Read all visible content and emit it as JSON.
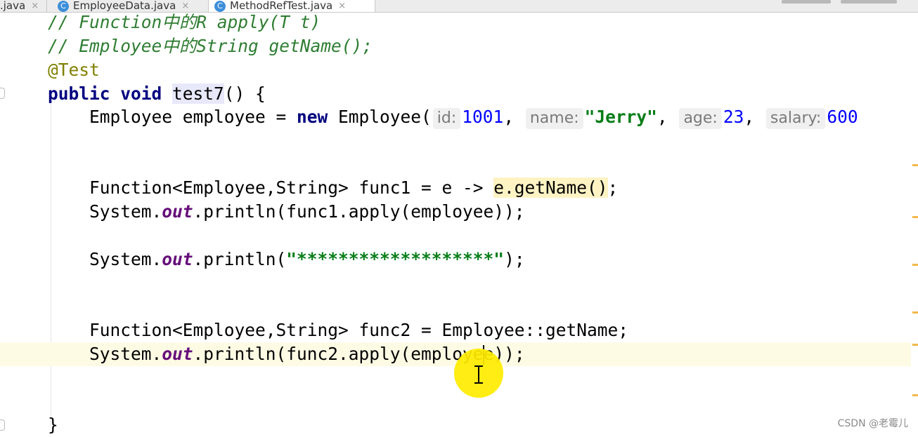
{
  "tabs": [
    {
      "label": ".java",
      "close": "×"
    },
    {
      "label": "EmployeeData.java",
      "icon": "C",
      "close": "×"
    },
    {
      "label": "MethodRefTest.java",
      "icon": "C",
      "close": "×",
      "active": true
    }
  ],
  "code": {
    "l1_a": "// Function",
    "l1_b": "中的",
    "l1_c": "R apply(T t)",
    "l2_a": "// Employee",
    "l2_b": "中的",
    "l2_c": "String getName();",
    "l3": "@Test",
    "l4_kw": "public void",
    "l4_sp": " ",
    "l4_name": "test7",
    "l4_rest": "() {",
    "l5_a": "    Employee employee = ",
    "l5_new": "new",
    "l5_b": " Employee(",
    "hint_id": "id:",
    "v_id": "1001",
    "comma": ",",
    "hint_name": "name:",
    "v_name": "\"Jerry\"",
    "hint_age": "age:",
    "v_age": "23",
    "hint_salary": "salary:",
    "v_salary": "600",
    "l6_a": "    Function<Employee,String> func1 = e -> ",
    "l6_hl": "e.getName()",
    "l6_b": ";",
    "sys": "    System.",
    "out": "out",
    "l7_b": ".println(func1.apply(employee));",
    "l8_b": ".println(",
    "l8_str": "\"*******************\"",
    "l8_c": ");",
    "l9": "    Function<Employee,String> func2 = Employee::getName;",
    "l10_b": ".println(func2.apply(emplo",
    "l10_c": "ye",
    "l10_d": "e));",
    "l11": "}"
  },
  "watermark": "CSDN @老霉儿",
  "colors": {
    "keyword": "#000080",
    "comment": "#2e7d32",
    "annotation": "#808000",
    "number": "#0000ff",
    "string": "#067d17",
    "field": "#660e7a",
    "cursor_highlight": "#ffec00"
  }
}
